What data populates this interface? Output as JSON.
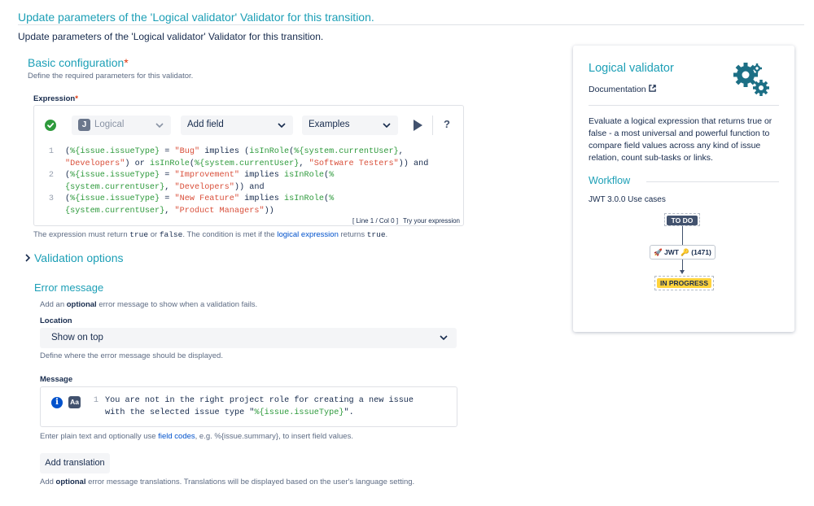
{
  "page": {
    "heading": "Update parameters of the 'Logical validator' Validator for this transition.",
    "subheading": "Update parameters of the 'Logical validator' Validator for this transition."
  },
  "basic": {
    "title": "Basic configuration",
    "required_mark": "*",
    "description": "Define the required parameters for this validator.",
    "expression_label": "Expression",
    "expression_required": "*"
  },
  "toolbar": {
    "parser_select": "Logical",
    "parser_icon": "J",
    "add_field_select": "Add field",
    "examples_select": "Examples",
    "help_label": "?"
  },
  "editor": {
    "line_numbers": [
      "1",
      "",
      "2",
      "",
      "3",
      ""
    ],
    "status": "[ Line 1 / Col 0 ]",
    "try_label": "Try your expression"
  },
  "expression_help": {
    "part1": "The expression must return ",
    "code_true": "true",
    "part2": " or ",
    "code_false": "false",
    "part3": ". The condition is met if the ",
    "link": "logical expression",
    "part4": " returns ",
    "code_true2": "true",
    "part5": "."
  },
  "validation_options": {
    "chevron": "›",
    "title": "Validation options"
  },
  "error_message": {
    "title": "Error message",
    "desc_part1": "Add an ",
    "desc_bold": "optional",
    "desc_part2": " error message to show when a validation fails.",
    "location_label": "Location",
    "location_value": "Show on top",
    "location_help": "Define where the error message should be displayed.",
    "message_label": "Message",
    "info_icon": "i",
    "aa_icon": "Aa",
    "message_line_number": "1",
    "message_line1": "You are not in the right project role for creating a new issue",
    "message_line2_a": "with the selected issue type \"",
    "message_line2_var": "%{issue.issueType}",
    "message_line2_b": "\".",
    "message_help_part1": "Enter plain text and optionally use ",
    "message_help_link": "field codes",
    "message_help_part2": ", e.g. %{issue.summary}, to insert field values.",
    "add_translation": "Add translation",
    "translation_help_part1": "Add ",
    "translation_help_bold": "optional",
    "translation_help_part2": " error message translations. Translations will be displayed based on the user's language setting."
  },
  "card": {
    "title": "Logical validator",
    "documentation": "Documentation",
    "description": "Evaluate a logical expression that returns true or false - a most universal and powerful function to compare field values across any kind of issue relation, count sub-tasks or links.",
    "workflow_title": "Workflow",
    "use_cases": "JWT 3.0.0 Use cases",
    "wf_from": "TO DO",
    "wf_transition": "🚀 JWT 🔑 (1471)",
    "wf_to": "IN PROGRESS"
  },
  "colors": {
    "accent": "#1c9fb6",
    "success": "#2e9a3c",
    "string": "#d94f3a",
    "link": "#0052cc"
  }
}
